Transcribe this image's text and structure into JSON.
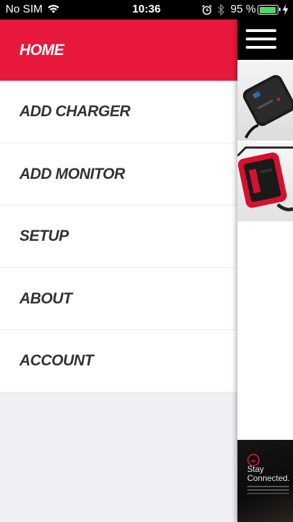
{
  "status_bar": {
    "carrier": "No SIM",
    "time": "10:36",
    "battery_percent": "95 %",
    "battery_level": 0.95,
    "battery_color": "#4cd964"
  },
  "menu": {
    "accent_color": "#e8193c",
    "items": [
      {
        "label": "HOME",
        "active": true
      },
      {
        "label": "ADD CHARGER",
        "active": false
      },
      {
        "label": "ADD MONITOR",
        "active": false
      },
      {
        "label": "SETUP",
        "active": false
      },
      {
        "label": "ABOUT",
        "active": false
      },
      {
        "label": "ACCOUNT",
        "active": false
      }
    ]
  },
  "main": {
    "menu_icon": "hamburger-icon",
    "promo": {
      "title_line1": "Stay",
      "title_line2": "Connected.",
      "icon": "wifi-signal-icon"
    }
  }
}
